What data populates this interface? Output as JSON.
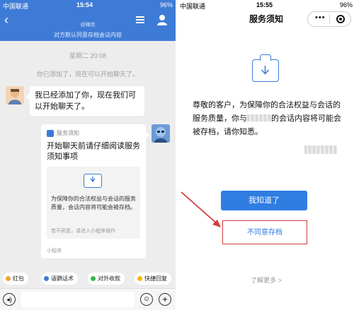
{
  "left": {
    "status": {
      "carrier": "中国联通",
      "time": "15:54",
      "battery": "96%"
    },
    "nav": {
      "back_glyph": "‹",
      "subtitle": "@微信",
      "banner": "对方默认同意存档会话内容"
    },
    "timestamp": "星期二 20:08",
    "system_msg": "你已添加了，现在可以开始聊天了。",
    "bubble_text": "我已经添加了你，现在我们可以开始聊天了。",
    "card": {
      "header": "服务须知",
      "title": "开始聊天前请仔细阅读服务须知事项",
      "body": "为保障你的合法权益与会话的服务质量，会话内容将可能会被存档。",
      "note": "若不同意，请进入小程序操作",
      "footer": "小程序"
    },
    "quick_replies": [
      {
        "label": "红包",
        "color": "#f0a33a"
      },
      {
        "label": "语鹦话术",
        "color": "#3d7bd6"
      },
      {
        "label": "对外收款",
        "color": "#39b54a"
      },
      {
        "label": "快捷回复",
        "color": "#f5b800"
      }
    ],
    "input": {
      "voice_glyph": "◂)",
      "emoji_glyph": "☺",
      "plus_glyph": "+"
    }
  },
  "right": {
    "status": {
      "carrier": "中国联通",
      "time": "15:55",
      "battery": "96%"
    },
    "title": "服务须知",
    "capsule_dots": "•••",
    "text_part1": "尊敬的客户，为保障你的合法权益与会话的服务质量，你与",
    "text_part2": "的会话内容将可能会被存档，请你知悉。",
    "ok_label": "我知道了",
    "reject_label": "不同意存档",
    "more_label": "了解更多 >"
  },
  "colors": {
    "accent": "#3d7bd6",
    "button": "#2f7de1",
    "highlight": "#d43b3b"
  }
}
